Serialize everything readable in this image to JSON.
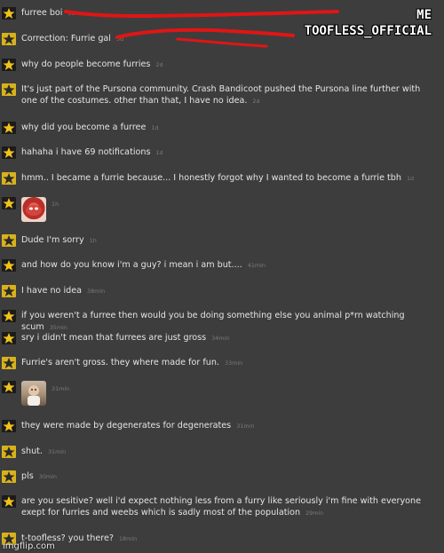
{
  "overlay": {
    "line1": "ME",
    "line2": "TOOFLESS_OFFICIAL"
  },
  "watermark": "imgflip.com",
  "colors": {
    "background": "#3d3d3d",
    "text": "#e4e4e4",
    "timestamp": "#7a7a7a",
    "scribble": "#e01515"
  },
  "messages": [
    {
      "text": "furree boi",
      "time": "3d",
      "avatar": "star-dark"
    },
    {
      "text": "Correction: Furrie gal",
      "time": "3d",
      "avatar": "star-yellow"
    },
    {
      "text": "why do people become furries",
      "time": "2d",
      "avatar": "star-dark"
    },
    {
      "text": "It's just part of the Pursona community. Crash Bandicoot pushed the Pursona line further with one of the costumes. other than that, I have no idea.",
      "time": "2d",
      "avatar": "star-yellow"
    },
    {
      "text": "why did you become a furree",
      "time": "1d",
      "avatar": "star-dark"
    },
    {
      "text": "hahaha i have 69 notifications",
      "time": "1d",
      "avatar": "star-dark"
    },
    {
      "text": "hmm.. I became a furrie because... I honestly forgot why I wanted to become a furrie tbh",
      "time": "1d",
      "avatar": "star-yellow"
    },
    {
      "text": "",
      "time": "1h",
      "avatar": "star-dark",
      "image": "red-sticker"
    },
    {
      "text": "Dude I'm sorry",
      "time": "1h",
      "avatar": "star-yellow"
    },
    {
      "text": "and how do you know i'm a guy? i mean i am but....",
      "time": "41min",
      "avatar": "star-dark"
    },
    {
      "text": "I have no idea",
      "time": "38min",
      "avatar": "star-yellow"
    },
    {
      "text": "if you weren't a furree then would you be doing something else you animal p*rn watching scum",
      "time": "35min",
      "avatar": "star-dark"
    },
    {
      "text": "sry i didn't mean that furrees are just gross",
      "time": "34min",
      "avatar": "star-dark"
    },
    {
      "text": "Furrie's aren't gross. they where made for fun.",
      "time": "33min",
      "avatar": "star-yellow"
    },
    {
      "text": "",
      "time": "31min",
      "avatar": "star-dark",
      "image": "kid-photo"
    },
    {
      "text": "they were made by degenerates for degenerates",
      "time": "31min",
      "avatar": "star-dark"
    },
    {
      "text": "shut.",
      "time": "31min",
      "avatar": "star-yellow"
    },
    {
      "text": "pls",
      "time": "30min",
      "avatar": "star-yellow"
    },
    {
      "text": "are you sesitive? well i'd expect nothing less from a furry like seriously i'm fine with everyone exept for furries and weebs which is sadly most of the population",
      "time": "29min",
      "avatar": "star-dark"
    },
    {
      "text": "t-toofless? you there?",
      "time": "18min",
      "avatar": "star-yellow"
    }
  ]
}
